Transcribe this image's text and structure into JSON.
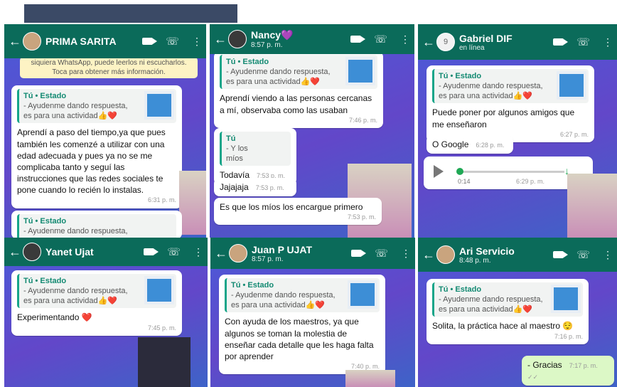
{
  "chats": [
    {
      "name": "PRIMA SARITA",
      "notice_line1": "siquiera WhatsApp, puede leerlos ni escucharlos.",
      "notice_line2": "Toca para obtener más información.",
      "quote_label": "Tú • Estado",
      "quote_text": "- Ayudenme dando respuesta, es para una actividad👍❤️",
      "message": "Aprendí a paso del tiempo,ya que pues también les comenzé a utilizar con una edad adecuada y pues ya no se me complicaba tanto y seguí las instrucciones que las redes sociales te pone cuando lo recién lo instalas.",
      "time": "6:31 p. m.",
      "quote2_label": "Tú • Estado",
      "quote2_text": "- Ayudenme dando respuesta,"
    },
    {
      "name": "Nancy💜",
      "subtitle": "8:57 p. m.",
      "quote_label": "Tú • Estado",
      "quote_text": "- Ayudenme dando respuesta, es para una actividad👍❤️",
      "message": "Aprendí viendo a las personas cercanas a mí, observaba como las usaban",
      "time": "7:46 p. m.",
      "quote2_label": "Tú",
      "quote2_text": "- Y los míos",
      "m2": "Todavía",
      "t2": "7:53 p. m.",
      "m3": "Jajajaja",
      "t3": "7:53 p. m.",
      "m4": "Es que los míos los encargue primero",
      "t4": "7:53 p. m."
    },
    {
      "name": "Gabriel DIF",
      "subtitle": "en línea",
      "avatar_text": "9",
      "quote_label": "Tú • Estado",
      "quote_text": "- Ayudenme dando respuesta, es para una actividad👍❤️",
      "message": "Puede poner por algunos amigos que me enseñaron",
      "time": "6:27 p. m.",
      "m2": "O Google",
      "t2": "6:28 p. m.",
      "audio_duration": "0:14",
      "audio_time": "6:29 p. m."
    },
    {
      "name": "Yanet Ujat",
      "quote_label": "Tú • Estado",
      "quote_text": "- Ayudenme dando respuesta, es para una actividad👍❤️",
      "message": "Experimentando ❤️",
      "time": "7:45 p. m."
    },
    {
      "name": "Juan P UJAT",
      "subtitle": "8:57 p. m.",
      "quote_label": "Tú • Estado",
      "quote_text": "- Ayudenme dando respuesta, es para una actividad👍❤️",
      "message": "Con ayuda de los maestros, ya que algunos se toman la molestia de enseñar cada detalle que les haga falta por aprender",
      "time": "7:40 p. m."
    },
    {
      "name": "Ari Servicio",
      "subtitle": "8:48 p. m.",
      "quote_label": "Tú • Estado",
      "quote_text": "- Ayudenme dando respuesta, es para una actividad👍❤️",
      "message": "Solita, la práctica hace al maestro 😌",
      "time": "7:16 p. m.",
      "reply": "- Gracias",
      "reply_time": "7:17 p. m. ✓✓"
    }
  ],
  "icons": {
    "back": "arrow-left-icon",
    "video": "video-call-icon",
    "call": "phone-icon",
    "menu": "more-vert-icon"
  },
  "colors": {
    "header": "#0b6b5a",
    "quote_bar": "#17a589",
    "outgoing": "#dcf8c6"
  }
}
